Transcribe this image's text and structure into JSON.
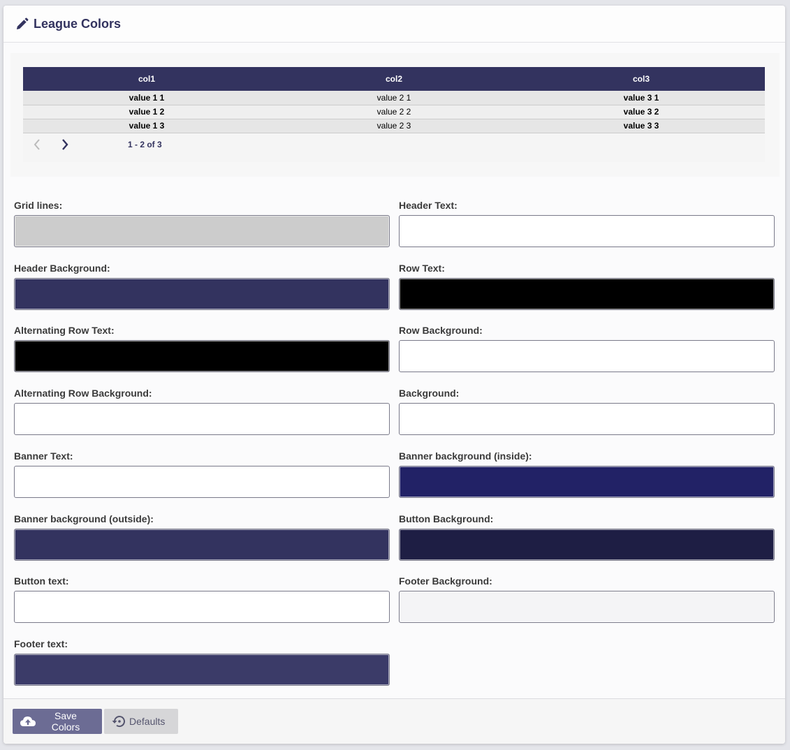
{
  "header": {
    "title": "League Colors",
    "icon": "pencil-icon"
  },
  "preview": {
    "columns": [
      "col1",
      "col2",
      "col3"
    ],
    "rows": [
      [
        "value 1 1",
        "value 2 1",
        "value 3 1"
      ],
      [
        "value 1 2",
        "value 2 2",
        "value 3 2"
      ],
      [
        "value 1 3",
        "value 2 3",
        "value 3 3"
      ]
    ],
    "pager_text": "1 - 2 of 3"
  },
  "fields": [
    {
      "label": "Grid lines:",
      "color": "#cccccc"
    },
    {
      "label": "Header Text:",
      "color": "#ffffff"
    },
    {
      "label": "Header Background:",
      "color": "#33335f"
    },
    {
      "label": "Row Text:",
      "color": "#000000"
    },
    {
      "label": "Alternating Row Text:",
      "color": "#000000"
    },
    {
      "label": "Row Background:",
      "color": "#ffffff"
    },
    {
      "label": "Alternating Row Background:",
      "color": "#ffffff"
    },
    {
      "label": "Background:",
      "color": "#ffffff"
    },
    {
      "label": "Banner Text:",
      "color": "#ffffff"
    },
    {
      "label": "Banner background (inside):",
      "color": "#222266"
    },
    {
      "label": "Banner background (outside):",
      "color": "#33335f"
    },
    {
      "label": "Button Background:",
      "color": "#1e1e44"
    },
    {
      "label": "Button text:",
      "color": "#ffffff"
    },
    {
      "label": "Footer Background:",
      "color": "#f4f4f6"
    },
    {
      "label": "Footer text:",
      "color": "#3b3b68"
    }
  ],
  "footer": {
    "save_label": "Save Colors",
    "defaults_label": "Defaults"
  }
}
